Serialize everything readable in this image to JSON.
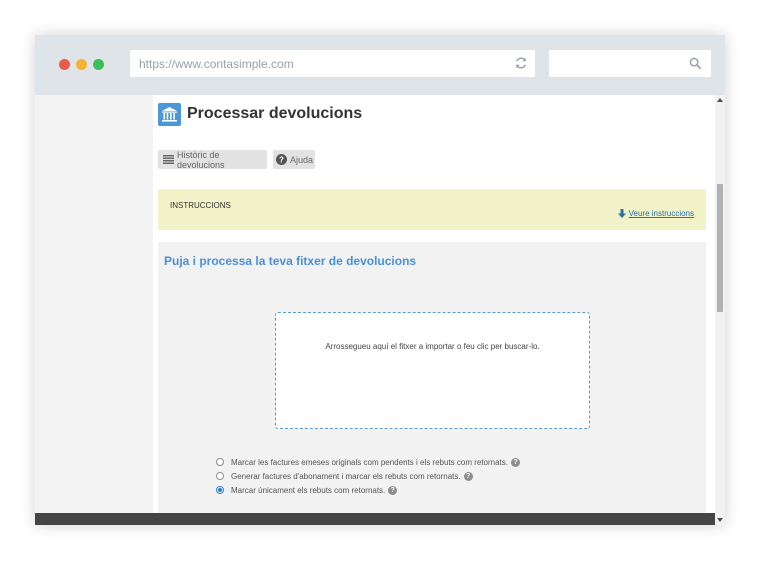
{
  "browser": {
    "url": "https://www.contasimple.com",
    "search_value": "",
    "icons": {
      "reload": "reload-icon",
      "search": "search-icon"
    },
    "traffic_lights": {
      "close": "#ee5a4a",
      "minimize": "#f2b437",
      "maximize": "#3cbf5a"
    }
  },
  "page": {
    "title": "Processar devolucions",
    "title_icon": "bank-icon",
    "accent": "#4a97d9"
  },
  "toolbar": {
    "history_label": "Històric de devolucions",
    "history_icon": "list-icon",
    "help_label": "Ajuda",
    "help_icon": "question-icon"
  },
  "instructions": {
    "title": "INSTRUCCIONS",
    "link_label": "Veure instruccions",
    "link_icon": "arrow-down-icon",
    "background": "#f1f2c7"
  },
  "upload": {
    "title": "Puja i processa la teva fitxer de devolucions",
    "dropzone_text": "Arrossegueu aquí el fitxer a importar o feu clic per buscar-lo."
  },
  "options": [
    {
      "label": "Marcar les factures emeses originals com pendents i els rebuts com retornats.",
      "checked": false
    },
    {
      "label": "Generar factures d'abonament i marcar els rebuts com retornats.",
      "checked": false
    },
    {
      "label": "Marcar únicament els rebuts com retornats.",
      "checked": true
    }
  ]
}
